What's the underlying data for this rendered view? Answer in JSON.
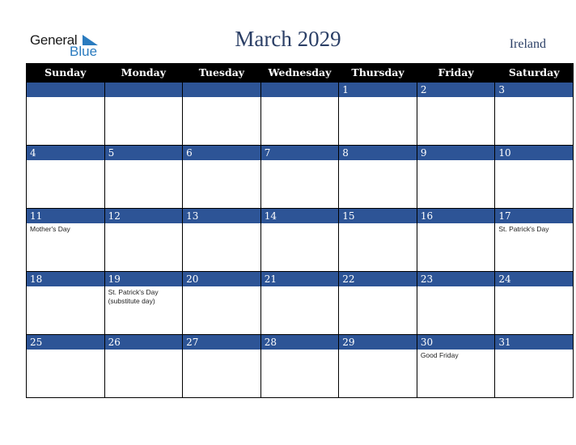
{
  "logo": {
    "general": "General",
    "blue": "Blue"
  },
  "title": "March 2029",
  "country": "Ireland",
  "weekdays": [
    "Sunday",
    "Monday",
    "Tuesday",
    "Wednesday",
    "Thursday",
    "Friday",
    "Saturday"
  ],
  "weeks": [
    [
      {
        "d": "",
        "e": ""
      },
      {
        "d": "",
        "e": ""
      },
      {
        "d": "",
        "e": ""
      },
      {
        "d": "",
        "e": ""
      },
      {
        "d": "1",
        "e": ""
      },
      {
        "d": "2",
        "e": ""
      },
      {
        "d": "3",
        "e": ""
      }
    ],
    [
      {
        "d": "4",
        "e": ""
      },
      {
        "d": "5",
        "e": ""
      },
      {
        "d": "6",
        "e": ""
      },
      {
        "d": "7",
        "e": ""
      },
      {
        "d": "8",
        "e": ""
      },
      {
        "d": "9",
        "e": ""
      },
      {
        "d": "10",
        "e": ""
      }
    ],
    [
      {
        "d": "11",
        "e": "Mother's Day"
      },
      {
        "d": "12",
        "e": ""
      },
      {
        "d": "13",
        "e": ""
      },
      {
        "d": "14",
        "e": ""
      },
      {
        "d": "15",
        "e": ""
      },
      {
        "d": "16",
        "e": ""
      },
      {
        "d": "17",
        "e": "St. Patrick's Day"
      }
    ],
    [
      {
        "d": "18",
        "e": ""
      },
      {
        "d": "19",
        "e": "St. Patrick's Day (substitute day)"
      },
      {
        "d": "20",
        "e": ""
      },
      {
        "d": "21",
        "e": ""
      },
      {
        "d": "22",
        "e": ""
      },
      {
        "d": "23",
        "e": ""
      },
      {
        "d": "24",
        "e": ""
      }
    ],
    [
      {
        "d": "25",
        "e": ""
      },
      {
        "d": "26",
        "e": ""
      },
      {
        "d": "27",
        "e": ""
      },
      {
        "d": "28",
        "e": ""
      },
      {
        "d": "29",
        "e": ""
      },
      {
        "d": "30",
        "e": "Good Friday"
      },
      {
        "d": "31",
        "e": ""
      }
    ]
  ]
}
